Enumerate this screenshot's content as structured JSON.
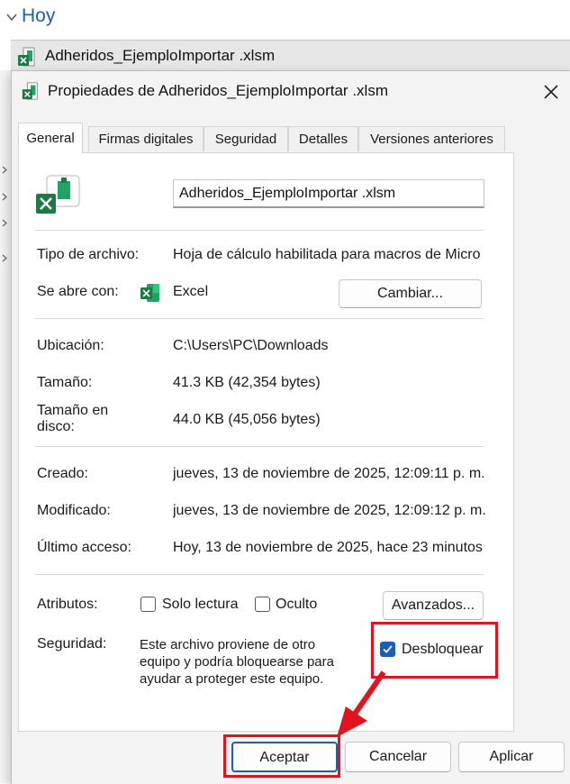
{
  "explorer": {
    "group_title": "Hoy",
    "file_name": "Adheridos_EjemploImportar .xlsm"
  },
  "dialog": {
    "title": "Propiedades de Adheridos_EjemploImportar .xlsm",
    "tabs": [
      "General",
      "Firmas digitales",
      "Seguridad",
      "Detalles",
      "Versiones anteriores"
    ],
    "active_tab": "General",
    "file_name_value": "Adheridos_EjemploImportar .xlsm",
    "tipo_label": "Tipo de archivo:",
    "tipo_value": "Hoja de cálculo habilitada para macros de Micro",
    "abre_label": "Se abre con:",
    "abre_value": "Excel",
    "cambiar_label": "Cambiar...",
    "ubicacion_label": "Ubicación:",
    "ubicacion_value": "C:\\Users\\PC\\Downloads",
    "tamano_label": "Tamaño:",
    "tamano_value": "41.3 KB (42,354 bytes)",
    "tamano_disco_label_1": "Tamaño en",
    "tamano_disco_label_2": "disco:",
    "tamano_disco_value": "44.0 KB (45,056 bytes)",
    "creado_label": "Creado:",
    "creado_value": "jueves, 13 de noviembre de 2025, 12:09:11 p. m.",
    "modificado_label": "Modificado:",
    "modificado_value": "jueves, 13 de noviembre de 2025, 12:09:12 p. m.",
    "acceso_label": "Último acceso:",
    "acceso_value": "Hoy, 13 de noviembre de 2025, hace 23 minutos",
    "atributos_label": "Atributos:",
    "solo_lectura_label": "Solo lectura",
    "solo_lectura_checked": false,
    "oculto_label": "Oculto",
    "oculto_checked": false,
    "avanzados_label": "Avanzados...",
    "seguridad_label": "Seguridad:",
    "seguridad_text_1": "Este archivo proviene de otro",
    "seguridad_text_2": "equipo y podría bloquearse para",
    "seguridad_text_3": "ayudar a proteger este equipo.",
    "desbloquear_label": "Desbloquear",
    "desbloquear_checked": true,
    "aceptar_label": "Aceptar",
    "cancelar_label": "Cancelar",
    "aplicar_label": "Aplicar"
  },
  "colors": {
    "annotation_red": "#e0141e",
    "checkbox_blue": "#1a5fb4",
    "excel_green": "#1d7a45",
    "group_title_blue": "#1f5fa8"
  },
  "icons": {
    "file_icon": "excel-macro-file-icon",
    "opens_with_icon": "excel-app-icon",
    "close": "close-icon"
  }
}
